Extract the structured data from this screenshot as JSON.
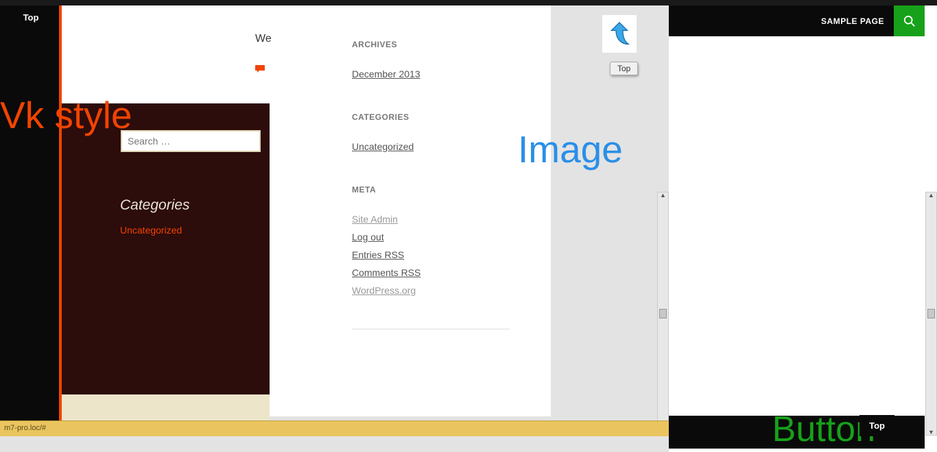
{
  "topbar": {},
  "left": {
    "top_badge": "Top",
    "vk_style": "Vk style",
    "search_placeholder": "Search …",
    "categories_heading": "Categories",
    "categories_link": "Uncategorized",
    "post_snippet": "We",
    "arrow_top_label": "Top",
    "image_overlay": "Image"
  },
  "widgets": {
    "archives_title": "ARCHIVES",
    "archives_link": "December 2013",
    "categories_title": "CATEGORIES",
    "categories_link": "Uncategorized",
    "meta_title": "META",
    "meta_links": {
      "site_admin": "Site Admin",
      "log_out": "Log out",
      "entries_rss": "Entries RSS",
      "comments_rss": "Comments RSS",
      "wordpress": "WordPress.org"
    }
  },
  "right": {
    "sample_page": "SAMPLE PAGE",
    "button_overlay": "Button",
    "top_btn": "Top"
  },
  "status": "m7-pro.loc/#"
}
